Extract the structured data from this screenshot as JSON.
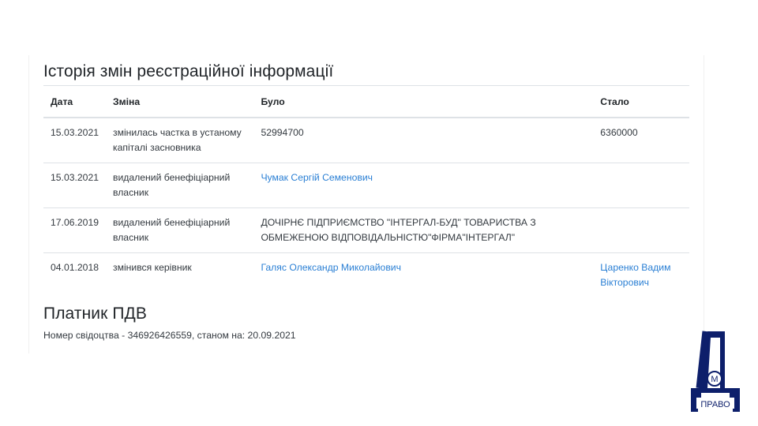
{
  "history": {
    "title": "Історія змін реєстраційної інформації",
    "columns": {
      "date": "Дата",
      "change": "Зміна",
      "was": "Було",
      "now": "Стало"
    },
    "rows": [
      {
        "date": "15.03.2021",
        "change": "змінилась частка в устаному капіталі засновника",
        "was": "52994700",
        "now": "6360000"
      },
      {
        "date": "15.03.2021",
        "change": "видалений бенефіціарний власник",
        "was": "Чумак Сергій Семенович",
        "now": ""
      },
      {
        "date": "17.06.2019",
        "change": "видалений бенефіціарний власник",
        "was": "ДОЧІРНЄ ПІДПРИЄМСТВО \"ІНТЕРГАЛ-БУД\" ТОВАРИСТВА З ОБМЕЖЕНОЮ ВІДПОВІДАЛЬНІСТЮ\"ФІРМА\"ІНТЕРГАЛ\"",
        "now": ""
      },
      {
        "date": "04.01.2018",
        "change": "змінився керівник",
        "was": "Галяс Олександр Миколайович",
        "now": "Царенко Вадим Вікторович"
      }
    ]
  },
  "vat": {
    "title": "Платник ПДВ",
    "certificate": "Номер свідоцтва - 346926426559, станом на: 20.09.2021"
  },
  "logo": {
    "circle_letter": "М",
    "caption": "ПРАВО",
    "color": "#0d1f6b"
  },
  "colors": {
    "link": "#2a7fd4",
    "text": "#212529",
    "border": "#dee2e6"
  }
}
